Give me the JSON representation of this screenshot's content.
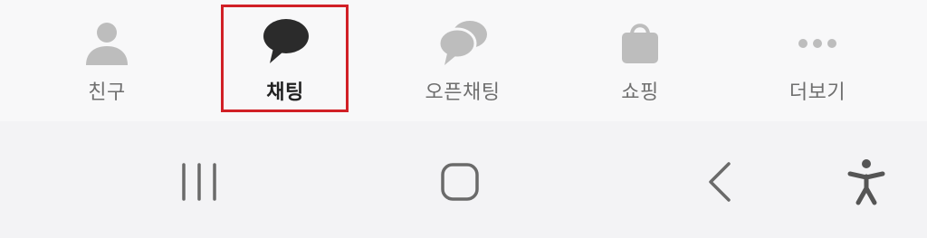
{
  "tabs": [
    {
      "label": "친구",
      "icon": "person-icon",
      "active": false
    },
    {
      "label": "채팅",
      "icon": "chat-bubble-icon",
      "active": true
    },
    {
      "label": "오픈채팅",
      "icon": "open-chat-icon",
      "active": false
    },
    {
      "label": "쇼핑",
      "icon": "shopping-bag-icon",
      "active": false
    },
    {
      "label": "더보기",
      "icon": "more-dots-icon",
      "active": false
    }
  ],
  "system_nav": {
    "recents": "recents-icon",
    "home": "home-icon",
    "back": "back-icon",
    "accessibility": "accessibility-icon"
  },
  "colors": {
    "active_icon": "#2b2b2b",
    "inactive_icon": "#bdbdbd",
    "highlight": "#d12026",
    "nav_icon": "#6a6a6a"
  }
}
